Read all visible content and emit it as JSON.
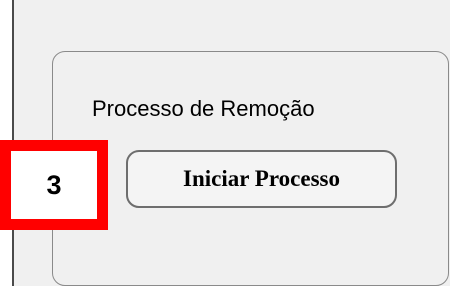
{
  "group": {
    "title": "Processo de Remoção"
  },
  "button": {
    "label": "Iniciar Processo"
  },
  "annotation": {
    "step_number": "3",
    "highlight_color": "#ff0000"
  }
}
